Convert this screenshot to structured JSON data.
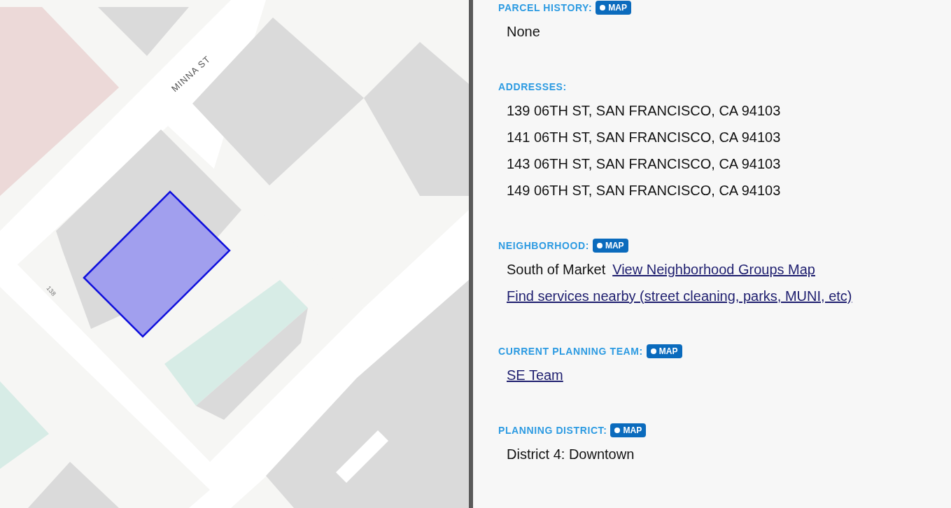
{
  "map": {
    "street_label": "MINNA ST",
    "parcel_label": "138"
  },
  "sections": [
    {
      "heading": "PARCEL HISTORY:",
      "map_button": "MAP",
      "lines": [
        {
          "kind": "text",
          "text": "None"
        }
      ]
    },
    {
      "heading": "ADDRESSES:",
      "lines": [
        {
          "kind": "text",
          "text": "139 06TH ST, SAN FRANCISCO, CA 94103"
        },
        {
          "kind": "text",
          "text": "141 06TH ST, SAN FRANCISCO, CA 94103"
        },
        {
          "kind": "text",
          "text": "143 06TH ST, SAN FRANCISCO, CA 94103"
        },
        {
          "kind": "text",
          "text": "149 06TH ST, SAN FRANCISCO, CA 94103"
        }
      ]
    },
    {
      "heading": "NEIGHBORHOOD:",
      "map_button": "MAP",
      "lines": [
        {
          "kind": "text_link",
          "text": "South of Market",
          "link": "View Neighborhood Groups Map"
        },
        {
          "kind": "link",
          "text": "Find services nearby (street cleaning, parks, MUNI, etc)"
        }
      ]
    },
    {
      "heading": "CURRENT PLANNING TEAM:",
      "map_button": "MAP",
      "lines": [
        {
          "kind": "link",
          "text": "SE Team"
        }
      ]
    },
    {
      "heading": "PLANNING DISTRICT:",
      "map_button": "MAP",
      "lines": [
        {
          "kind": "text",
          "text": "District 4: Downtown"
        }
      ]
    }
  ]
}
